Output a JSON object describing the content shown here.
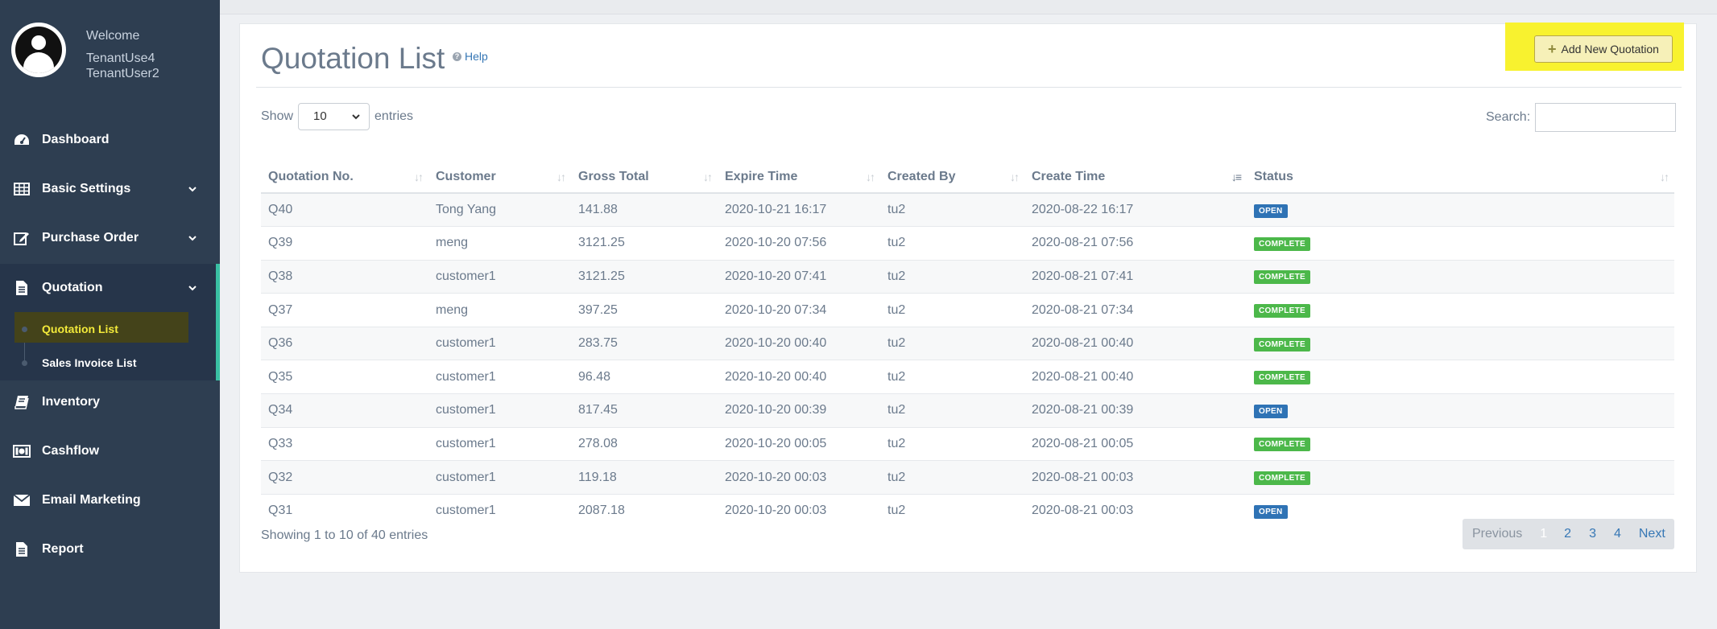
{
  "sidebar": {
    "welcome": "Welcome",
    "user_line1": "TenantUse4",
    "user_line2": "TenantUser2",
    "items": [
      {
        "label": "Dashboard",
        "icon": "dashboard-icon"
      },
      {
        "label": "Basic Settings",
        "icon": "table-icon"
      },
      {
        "label": "Purchase Order",
        "icon": "edit-icon"
      },
      {
        "label": "Quotation",
        "icon": "document-icon"
      },
      {
        "label": "Inventory",
        "icon": "book-icon"
      },
      {
        "label": "Cashflow",
        "icon": "money-icon"
      },
      {
        "label": "Email Marketing",
        "icon": "envelope-icon"
      },
      {
        "label": "Report",
        "icon": "report-icon"
      }
    ],
    "sub_items": [
      {
        "label": "Quotation List"
      },
      {
        "label": "Sales Invoice List"
      }
    ]
  },
  "header": {
    "title": "Quotation List",
    "help": "Help",
    "add_button": "Add New Quotation"
  },
  "controls": {
    "show_label": "Show",
    "show_value": "10",
    "entries_label": "entries",
    "search_label": "Search:"
  },
  "table": {
    "columns": [
      "Quotation No.",
      "Customer",
      "Gross Total",
      "Expire Time",
      "Created By",
      "Create Time",
      "Status"
    ],
    "rows": [
      [
        "Q40",
        "Tong Yang",
        "141.88",
        "2020-10-21 16:17",
        "tu2",
        "2020-08-22 16:17",
        "OPEN"
      ],
      [
        "Q39",
        "meng",
        "3121.25",
        "2020-10-20 07:56",
        "tu2",
        "2020-08-21 07:56",
        "COMPLETE"
      ],
      [
        "Q38",
        "customer1",
        "3121.25",
        "2020-10-20 07:41",
        "tu2",
        "2020-08-21 07:41",
        "COMPLETE"
      ],
      [
        "Q37",
        "meng",
        "397.25",
        "2020-10-20 07:34",
        "tu2",
        "2020-08-21 07:34",
        "COMPLETE"
      ],
      [
        "Q36",
        "customer1",
        "283.75",
        "2020-10-20 00:40",
        "tu2",
        "2020-08-21 00:40",
        "COMPLETE"
      ],
      [
        "Q35",
        "customer1",
        "96.48",
        "2020-10-20 00:40",
        "tu2",
        "2020-08-21 00:40",
        "COMPLETE"
      ],
      [
        "Q34",
        "customer1",
        "817.45",
        "2020-10-20 00:39",
        "tu2",
        "2020-08-21 00:39",
        "OPEN"
      ],
      [
        "Q33",
        "customer1",
        "278.08",
        "2020-10-20 00:05",
        "tu2",
        "2020-08-21 00:05",
        "COMPLETE"
      ],
      [
        "Q32",
        "customer1",
        "119.18",
        "2020-10-20 00:03",
        "tu2",
        "2020-08-21 00:03",
        "COMPLETE"
      ],
      [
        "Q31",
        "customer1",
        "2087.18",
        "2020-10-20 00:03",
        "tu2",
        "2020-08-21 00:03",
        "OPEN"
      ]
    ]
  },
  "footer": {
    "info": "Showing 1 to 10 of 40 entries",
    "pager": [
      "Previous",
      "1",
      "2",
      "3",
      "4",
      "Next"
    ]
  },
  "colors": {
    "sidebar": "#2e3e51",
    "accent": "#39c0a3",
    "open": "#2f73b5",
    "complete": "#4cb84a",
    "highlight": "#f8f22f"
  }
}
